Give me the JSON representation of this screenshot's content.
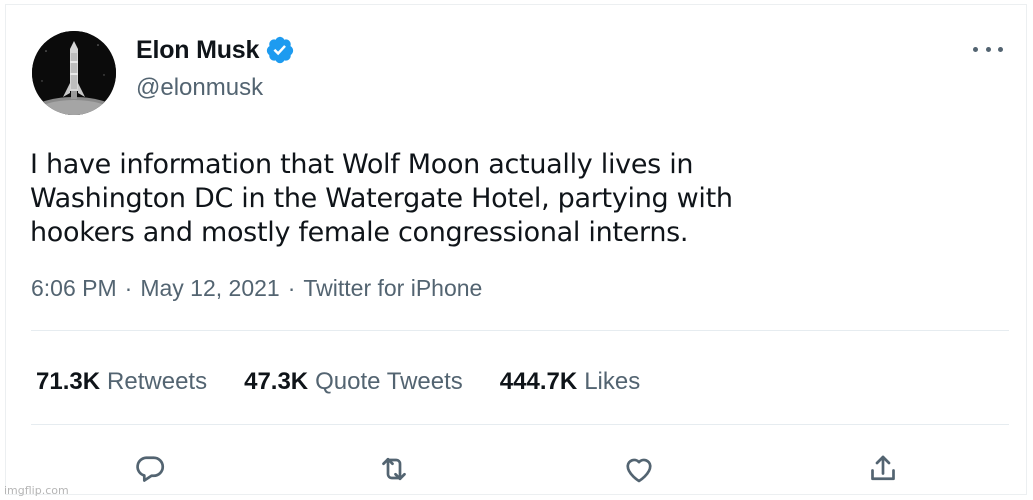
{
  "author": {
    "name": "Elon Musk",
    "handle": "@elonmusk",
    "verified": true,
    "avatar_icon": "rocket-icon"
  },
  "tweet": {
    "text_lines": [
      "I have information that Wolf Moon actually lives in",
      "Washington DC in the Watergate Hotel, partying with",
      "hookers and mostly female congressional interns."
    ]
  },
  "meta": {
    "time": "6:06 PM",
    "sep1": "·",
    "date": "May 12, 2021",
    "sep2": "·",
    "source": "Twitter for iPhone"
  },
  "stats": [
    {
      "count": "71.3K",
      "label": "Retweets"
    },
    {
      "count": "47.3K",
      "label": "Quote Tweets"
    },
    {
      "count": "444.7K",
      "label": "Likes"
    }
  ],
  "actions": [
    "reply-icon",
    "retweet-icon",
    "like-icon",
    "share-icon"
  ],
  "colors": {
    "verified": "#1d9bf0",
    "secondary_text": "#536471",
    "primary_text": "#0f1419",
    "divider": "#e6ecf0"
  },
  "watermark": "imgflip.com"
}
